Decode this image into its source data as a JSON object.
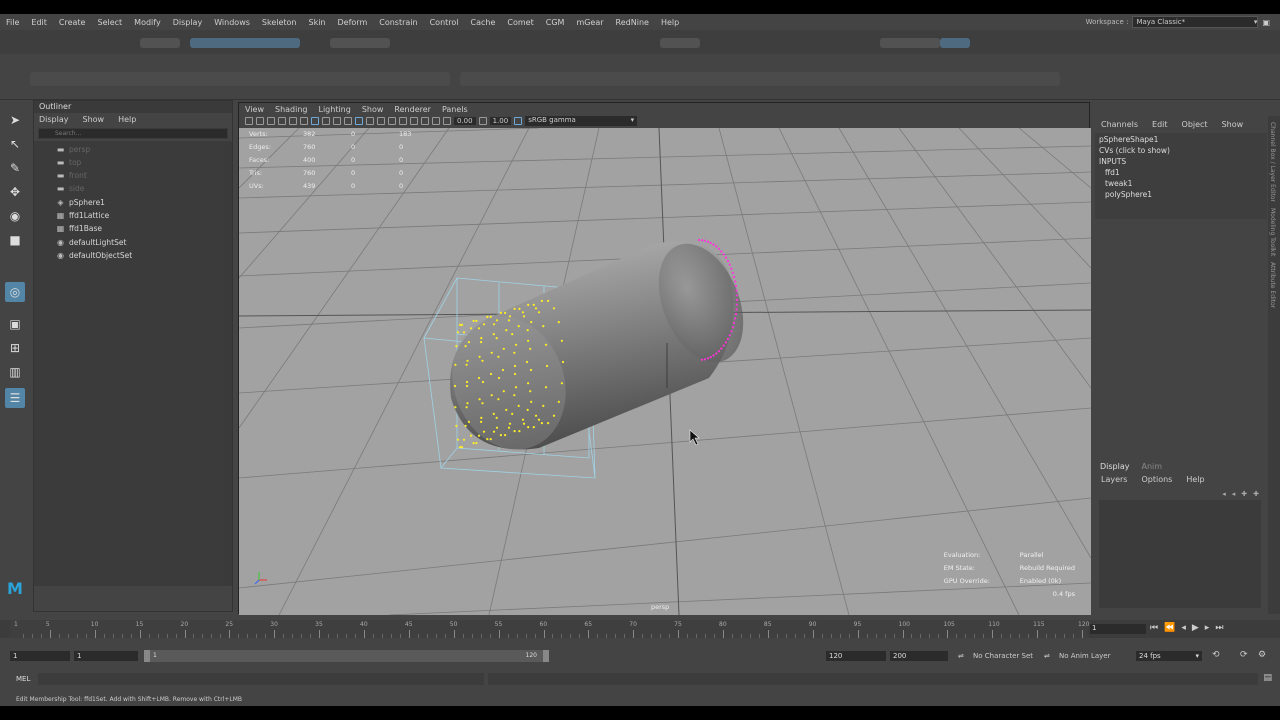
{
  "menubar": {
    "items": [
      "File",
      "Edit",
      "Create",
      "Select",
      "Modify",
      "Display",
      "Windows",
      "Skeleton",
      "Skin",
      "Deform",
      "Constrain",
      "Control",
      "Cache",
      "Comet",
      "CGM",
      "mGear",
      "RedNine",
      "Help"
    ],
    "workspace_label": "Workspace :",
    "workspace_value": "Maya Classic*"
  },
  "outliner": {
    "title": "Outliner",
    "menu": [
      "Display",
      "Show",
      "Help"
    ],
    "search_placeholder": "Search...",
    "items": [
      {
        "label": "persp",
        "icon": "camera-icon",
        "dim": true
      },
      {
        "label": "top",
        "icon": "camera-icon",
        "dim": true
      },
      {
        "label": "front",
        "icon": "camera-icon",
        "dim": true
      },
      {
        "label": "side",
        "icon": "camera-icon",
        "dim": true
      },
      {
        "label": "pSphere1",
        "icon": "mesh-icon",
        "dim": false
      },
      {
        "label": "ffd1Lattice",
        "icon": "lattice-icon",
        "dim": false
      },
      {
        "label": "ffd1Base",
        "icon": "lattice-icon",
        "dim": false
      },
      {
        "label": "defaultLightSet",
        "icon": "set-icon",
        "dim": false
      },
      {
        "label": "defaultObjectSet",
        "icon": "set-icon",
        "dim": false
      }
    ]
  },
  "viewport": {
    "menu": [
      "View",
      "Shading",
      "Lighting",
      "Show",
      "Renderer",
      "Panels"
    ],
    "exposure": "0.00",
    "gamma": "1.00",
    "color_space": "sRGB gamma",
    "stats": [
      {
        "k": "Verts:",
        "a": "382",
        "b": "0",
        "c": "183"
      },
      {
        "k": "Edges:",
        "a": "760",
        "b": "0",
        "c": "0"
      },
      {
        "k": "Faces:",
        "a": "400",
        "b": "0",
        "c": "0"
      },
      {
        "k": "Tris:",
        "a": "760",
        "b": "0",
        "c": "0"
      },
      {
        "k": "UVs:",
        "a": "439",
        "b": "0",
        "c": "0"
      }
    ],
    "eval": [
      {
        "k": "Evaluation:",
        "v": "Parallel"
      },
      {
        "k": "EM State:",
        "v": "Rebuild Required"
      },
      {
        "k": "GPU Override:",
        "v": "Enabled (0k)"
      }
    ],
    "fps": "0.4 fps",
    "camera": "persp"
  },
  "channelbox": {
    "menu": [
      "Channels",
      "Edit",
      "Object",
      "Show"
    ],
    "shape": "pSphereShape1",
    "cvs": "CVs (click to show)",
    "inputs_label": "INPUTS",
    "inputs": [
      "ffd1",
      "tweak1",
      "polySphere1"
    ],
    "tabs": [
      "Display",
      "Anim"
    ],
    "layer_menu": [
      "Layers",
      "Options",
      "Help"
    ],
    "side_tabs": [
      "Channel Box / Layer Editor",
      "Modeling Toolkit",
      "Attribute Editor"
    ]
  },
  "timeline": {
    "ticks": [
      "5",
      "10",
      "15",
      "20",
      "25",
      "30",
      "35",
      "40",
      "45",
      "50",
      "55",
      "60",
      "65",
      "70",
      "75",
      "80",
      "85",
      "90",
      "95",
      "100",
      "105",
      "110",
      "115",
      "120"
    ],
    "start_label": "1",
    "current_frame": "1"
  },
  "range": {
    "start": "1",
    "start2": "1",
    "slider_start": "1",
    "slider_end": "120",
    "end": "120",
    "end2": "200",
    "char_set": "No Character Set",
    "anim_layer": "No Anim Layer",
    "fps": "24 fps"
  },
  "cmd": {
    "label": "MEL"
  },
  "help": {
    "text": "Edit Membership Tool: ffd1Set. Add with Shift+LMB. Remove with Ctrl+LMB"
  }
}
